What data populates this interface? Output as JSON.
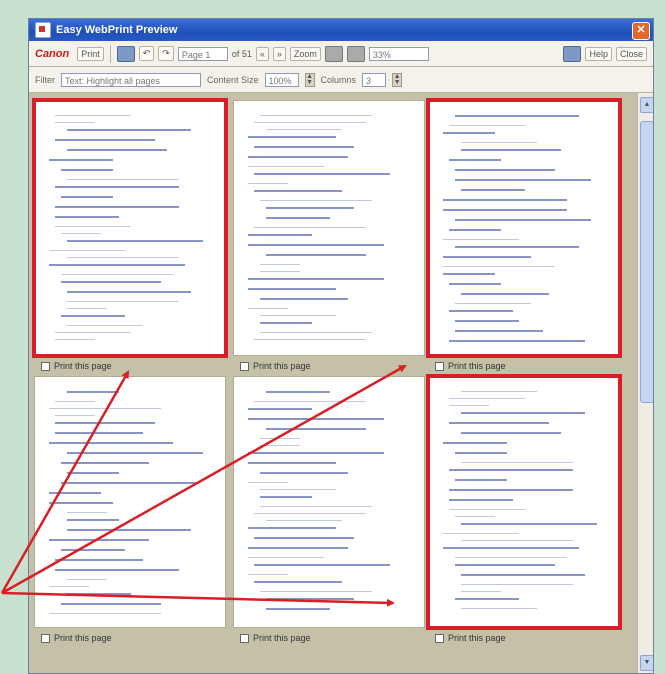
{
  "window": {
    "title": "Easy WebPrint Preview"
  },
  "toolbar1": {
    "brand": "Canon",
    "print_label": "Print",
    "page_label": "Page 1",
    "page_of": "of 51",
    "zoom_label": "Zoom",
    "zoom_value": "33%",
    "help_label": "Help",
    "close_label": "Close"
  },
  "toolbar2": {
    "filter_label": "Filter",
    "filter_placeholder": "Text: Highlight all pages",
    "content_size_label": "Content Size",
    "content_size_value": "100%",
    "columns_label": "Columns",
    "columns_value": "3"
  },
  "pages": [
    {
      "checkbox_label": "Print this page",
      "highlighted": true
    },
    {
      "checkbox_label": "Print this page",
      "highlighted": false
    },
    {
      "checkbox_label": "Print this page",
      "highlighted": true
    },
    {
      "checkbox_label": "Print this page",
      "highlighted": false
    },
    {
      "checkbox_label": "Print this page",
      "highlighted": false
    },
    {
      "checkbox_label": "Print this page",
      "highlighted": true
    }
  ],
  "colors": {
    "highlight": "#d81f26",
    "titlebar": "#2a59c2",
    "page_bg": "#c5c1a9"
  }
}
